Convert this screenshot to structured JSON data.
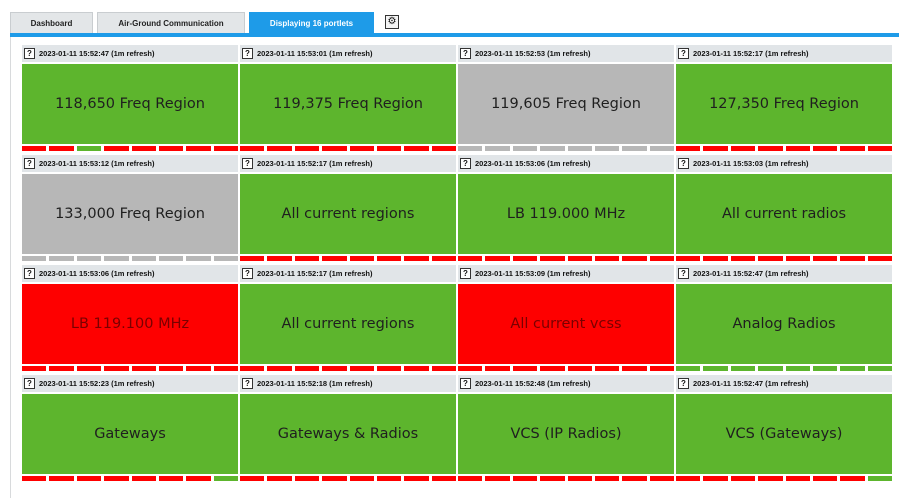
{
  "tabs": [
    {
      "label": "Dashboard"
    },
    {
      "label": "Air-Ground Communication"
    },
    {
      "label": "Displaying 16 portlets"
    }
  ],
  "settings_icon": "gear-icon",
  "help_label": "?",
  "colors": {
    "accent": "#1e9be8",
    "green": "#5db52d",
    "grey": "#b7b7b7",
    "red": "#fe0000"
  },
  "portlets": [
    {
      "timestamp": "2023-01-11 15:52:47 (1m refresh)",
      "title": "118,650 Freq Region",
      "status": "green",
      "segments": "rrgrrrrr"
    },
    {
      "timestamp": "2023-01-11 15:53:01 (1m refresh)",
      "title": "119,375 Freq Region",
      "status": "green",
      "segments": "rrrrrrrr"
    },
    {
      "timestamp": "2023-01-11 15:52:53 (1m refresh)",
      "title": "119,605 Freq Region",
      "status": "grey",
      "segments": "llllllll"
    },
    {
      "timestamp": "2023-01-11 15:52:17 (1m refresh)",
      "title": "127,350 Freq Region",
      "status": "green",
      "segments": "rrrrrrrr"
    },
    {
      "timestamp": "2023-01-11 15:53:12 (1m refresh)",
      "title": "133,000 Freq Region",
      "status": "grey",
      "segments": "llllllll"
    },
    {
      "timestamp": "2023-01-11 15:52:17 (1m refresh)",
      "title": "All current regions",
      "status": "green",
      "segments": "rrrrrrrr"
    },
    {
      "timestamp": "2023-01-11 15:53:06 (1m refresh)",
      "title": "LB 119.000 MHz",
      "status": "green",
      "segments": "rrrrrrrr"
    },
    {
      "timestamp": "2023-01-11 15:53:03 (1m refresh)",
      "title": "All current radios",
      "status": "green",
      "segments": "rrrrrrrr"
    },
    {
      "timestamp": "2023-01-11 15:53:06 (1m refresh)",
      "title": "LB 119.100 MHz",
      "status": "red",
      "segments": "rrrrrrrr"
    },
    {
      "timestamp": "2023-01-11 15:52:17 (1m refresh)",
      "title": "All current regions",
      "status": "green",
      "segments": "rrrrrrrr"
    },
    {
      "timestamp": "2023-01-11 15:53:09 (1m refresh)",
      "title": "All current vcss",
      "status": "red",
      "segments": "rrrrrrrr"
    },
    {
      "timestamp": "2023-01-11 15:52:47 (1m refresh)",
      "title": "Analog Radios",
      "status": "green",
      "segments": "gggggggg"
    },
    {
      "timestamp": "2023-01-11 15:52:23 (1m refresh)",
      "title": "Gateways",
      "status": "green",
      "segments": "rrrrrrrg"
    },
    {
      "timestamp": "2023-01-11 15:52:18 (1m refresh)",
      "title": "Gateways & Radios",
      "status": "green",
      "segments": "rrrrrrrr"
    },
    {
      "timestamp": "2023-01-11 15:52:48 (1m refresh)",
      "title": "VCS (IP Radios)",
      "status": "green",
      "segments": "rrrrrrrr"
    },
    {
      "timestamp": "2023-01-11 15:52:47 (1m refresh)",
      "title": "VCS (Gateways)",
      "status": "green",
      "segments": "rrrrrrrg"
    }
  ]
}
